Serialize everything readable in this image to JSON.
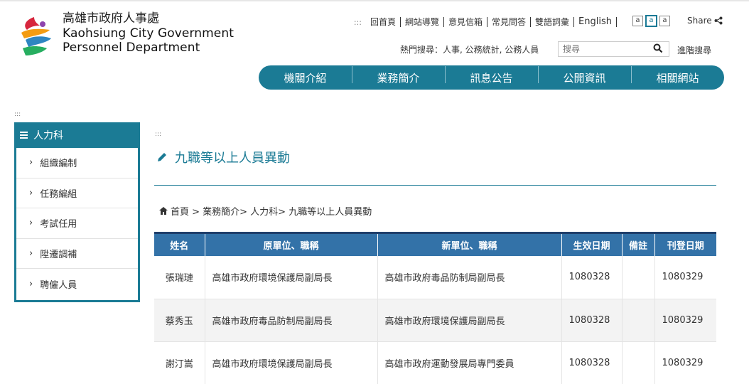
{
  "logo": {
    "zh": "高雄市政府人事處",
    "en1": "Kaohsiung City Government",
    "en2": "Personnel Department"
  },
  "toplinks": {
    "dots": ":::",
    "items": [
      "回首頁",
      "網站導覽",
      "意見信箱",
      "常見問答",
      "雙語詞彙",
      "English"
    ]
  },
  "fontsizes": [
    "a",
    "a",
    "a"
  ],
  "share": "Share",
  "hot_search": "熱門搜尋：人事, 公務統計, 公務人員",
  "search": {
    "placeholder": "搜尋"
  },
  "advanced_search": "進階搜尋",
  "mainnav": [
    "機關介紹",
    "業務簡介",
    "訊息公告",
    "公開資訊",
    "相關網站"
  ],
  "acc_dots": ":::",
  "sidebar": {
    "title": "人力科",
    "items": [
      "組織編制",
      "任務編組",
      "考試任用",
      "陞遷調補",
      "聘僱人員"
    ]
  },
  "page_title": "九職等以上人員異動",
  "breadcrumb": "首頁 > 業務簡介> 人力科> 九職等以上人員異動",
  "table": {
    "headers": [
      "姓名",
      "原單位、職稱",
      "新單位、職稱",
      "生效日期",
      "備註",
      "刊登日期"
    ],
    "rows": [
      [
        "張瑞璉",
        "高雄市政府環境保護局副局長",
        "高雄市政府毒品防制局副局長",
        "1080328",
        "",
        "1080329"
      ],
      [
        "蔡秀玉",
        "高雄市政府毒品防制局副局長",
        "高雄市政府環境保護局副局長",
        "1080328",
        "",
        "1080329"
      ],
      [
        "謝汀嵩",
        "高雄市政府環境保護局副局長",
        "高雄市政府運動發展局專門委員",
        "1080328",
        "",
        "1080329"
      ]
    ]
  },
  "colors": {
    "accent": "#1b7b95",
    "table_header": "#3372a8"
  }
}
